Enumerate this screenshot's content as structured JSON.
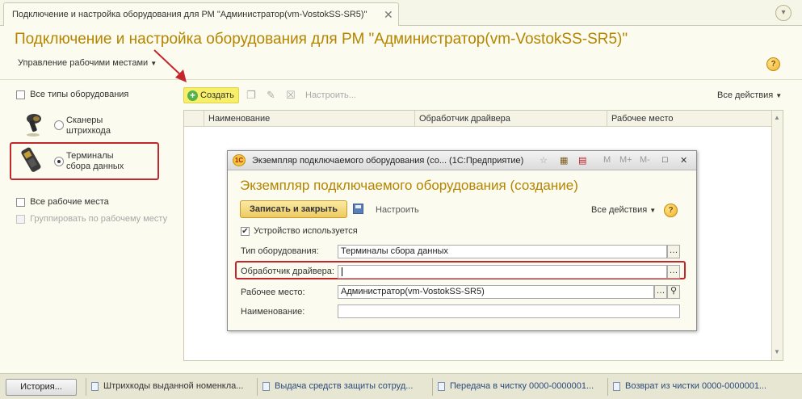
{
  "tab": {
    "title": "Подключение и настройка оборудования для РМ \"Администратор(vm-VostokSS-SR5)\"",
    "close_glyph": "✕"
  },
  "header": {
    "title": "Подключение и настройка оборудования для РМ \"Администратор(vm-VostokSS-SR5)\"",
    "menu_label": "Управление рабочими местами",
    "help_label": "?"
  },
  "left_panel": {
    "all_types_label": "Все типы оборудования",
    "all_types_checked": false,
    "equipment_types": [
      {
        "label": "Сканеры\nштрихкода",
        "selected": false,
        "icon": "barcode-scanner-icon"
      },
      {
        "label": "Терминалы\nсбора данных",
        "selected": true,
        "icon": "data-terminal-icon"
      }
    ],
    "all_workplaces_label": "Все рабочие места",
    "all_workplaces_checked": false,
    "group_by_workplace_label": "Группировать по рабочему месту",
    "group_by_workplace_enabled": false
  },
  "toolbar": {
    "create_label": "Создать",
    "setup_label": "Настроить...",
    "all_actions_label": "Все действия"
  },
  "table": {
    "columns": [
      "Наименование",
      "Обработчик драйвера",
      "Рабочее место"
    ],
    "rows": []
  },
  "dialog": {
    "title": "Экземпляр подключаемого оборудования (со... (1С:Предприятие)",
    "heading": "Экземпляр подключаемого оборудования (создание)",
    "save_close_label": "Записать и закрыть",
    "setup_label": "Настроить",
    "all_actions_label": "Все действия",
    "help_label": "?",
    "device_used_label": "Устройство используется",
    "device_used_checked": true,
    "fields": {
      "type_label": "Тип оборудования:",
      "type_value": "Терминалы сбора данных",
      "driver_label": "Обработчик драйвера:",
      "driver_value": "",
      "workplace_label": "Рабочее место:",
      "workplace_value": "Администратор(vm-VostokSS-SR5)",
      "name_label": "Наименование:",
      "name_value": ""
    },
    "window_buttons": [
      "M",
      "M+",
      "M-",
      "□",
      "✕"
    ]
  },
  "taskbar": {
    "history_label": "История...",
    "items": [
      "Штрихкоды выданной номенкла...",
      "Выдача средств защиты сотруд...",
      "Передача в чистку 0000-0000001...",
      "Возврат из чистки 0000-0000001..."
    ]
  },
  "colors": {
    "accent_title": "#b58500",
    "highlight_red": "#c3272b",
    "create_button": "#f7ef6a",
    "background": "#fbfbef"
  }
}
